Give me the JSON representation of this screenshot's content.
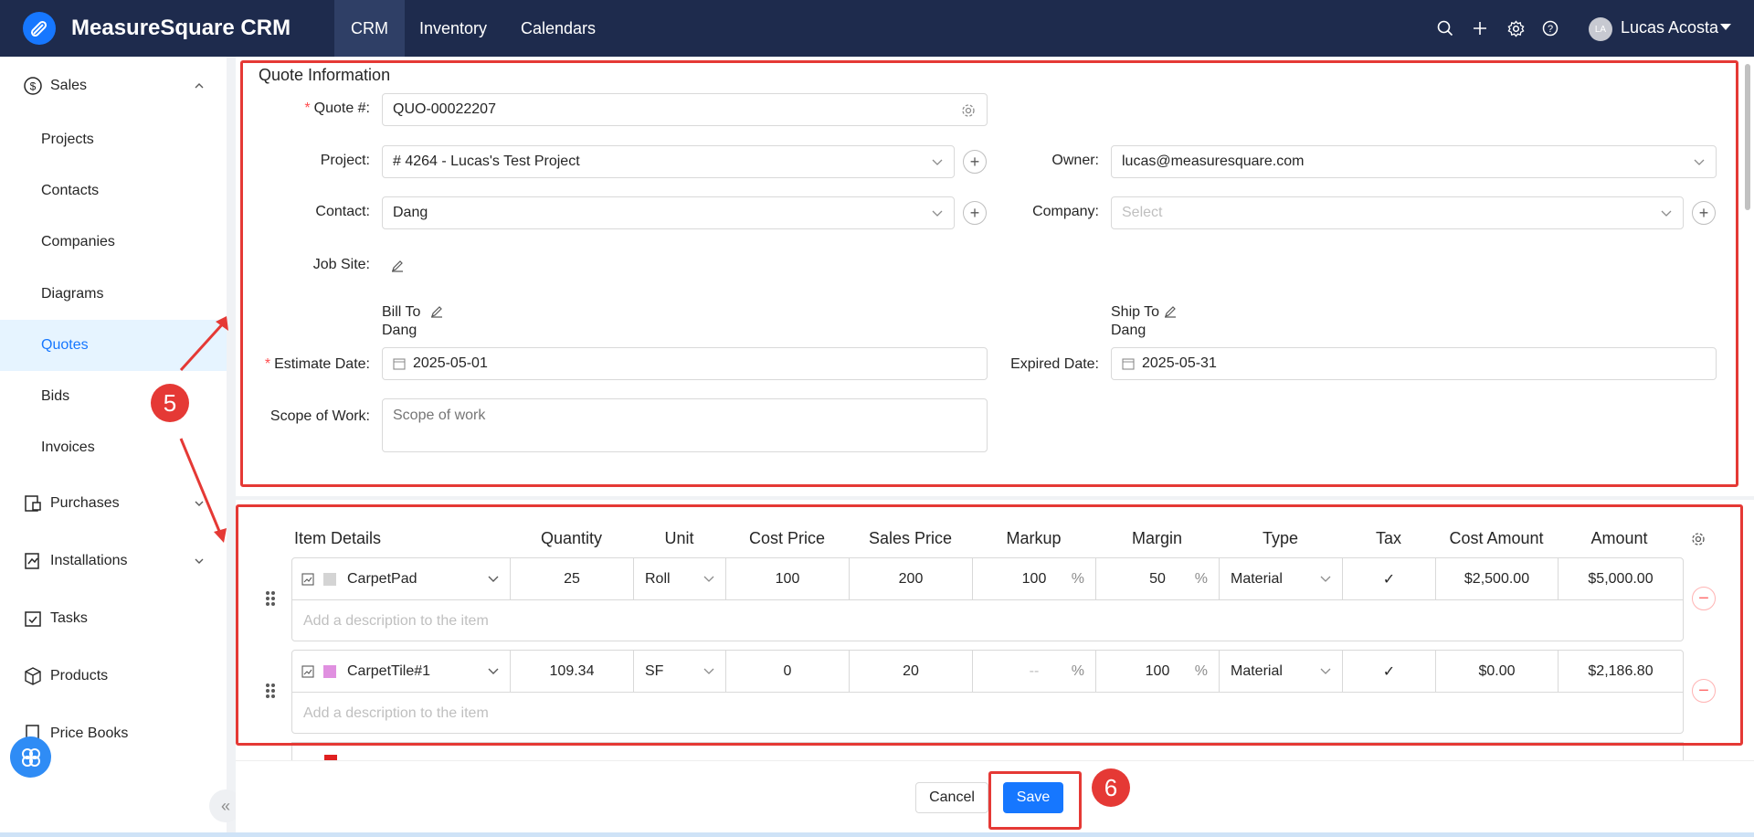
{
  "header": {
    "app_name": "MeasureSquare CRM",
    "tabs": [
      {
        "label": "CRM"
      },
      {
        "label": "Inventory"
      },
      {
        "label": "Calendars"
      }
    ],
    "user": {
      "initials": "LA",
      "name": "Lucas Acosta"
    }
  },
  "sidebar": {
    "sales_label": "Sales",
    "items": [
      {
        "label": "Projects"
      },
      {
        "label": "Contacts"
      },
      {
        "label": "Companies"
      },
      {
        "label": "Diagrams"
      },
      {
        "label": "Quotes"
      },
      {
        "label": "Bids"
      },
      {
        "label": "Invoices"
      }
    ],
    "groups": [
      {
        "label": "Purchases"
      },
      {
        "label": "Installations"
      },
      {
        "label": "Tasks"
      },
      {
        "label": "Products"
      },
      {
        "label": "Price Books"
      }
    ],
    "collapse": "«"
  },
  "quote": {
    "section_title": "Quote Information",
    "quote_no_label": "Quote #:",
    "quote_no": "QUO-00022207",
    "project_label": "Project:",
    "project": "# 4264 - Lucas's Test Project",
    "owner_label": "Owner:",
    "owner": "lucas@measuresquare.com",
    "contact_label": "Contact:",
    "contact": "Dang",
    "company_label": "Company:",
    "company_placeholder": "Select",
    "jobsite_label": "Job Site:",
    "bill_to": "Bill To",
    "bill_name": "Dang",
    "ship_to": "Ship To",
    "ship_name": "Dang",
    "estimate_label": "Estimate Date:",
    "estimate_date": "2025-05-01",
    "expired_label": "Expired Date:",
    "expired_date": "2025-05-31",
    "scope_label": "Scope of Work:",
    "scope_placeholder": "Scope of work"
  },
  "items": {
    "headers": {
      "details": "Item Details",
      "quantity": "Quantity",
      "unit": "Unit",
      "cost_price": "Cost Price",
      "sales_price": "Sales Price",
      "markup": "Markup",
      "margin": "Margin",
      "type": "Type",
      "tax": "Tax",
      "cost_amount": "Cost Amount",
      "amount": "Amount"
    },
    "desc_placeholder": "Add a description to the item",
    "percent": "%",
    "tax_check": "✓",
    "rows": [
      {
        "name": "CarpetPad",
        "swatch": "#d4d4d4",
        "quantity": "25",
        "unit": "Roll",
        "cost_price": "100",
        "sales_price": "200",
        "markup": "100",
        "margin": "50",
        "type": "Material",
        "cost_amount": "$2,500.00",
        "amount": "$5,000.00"
      },
      {
        "name": "CarpetTile#1",
        "swatch": "#e090e0",
        "quantity": "109.34",
        "unit": "SF",
        "cost_price": "0",
        "sales_price": "20",
        "markup": "--",
        "margin": "100",
        "type": "Material",
        "cost_amount": "$0.00",
        "amount": "$2,186.80"
      }
    ]
  },
  "footer": {
    "cancel": "Cancel",
    "save": "Save"
  },
  "annotations": {
    "step5": "5",
    "step6": "6",
    "color": "#e53935"
  }
}
